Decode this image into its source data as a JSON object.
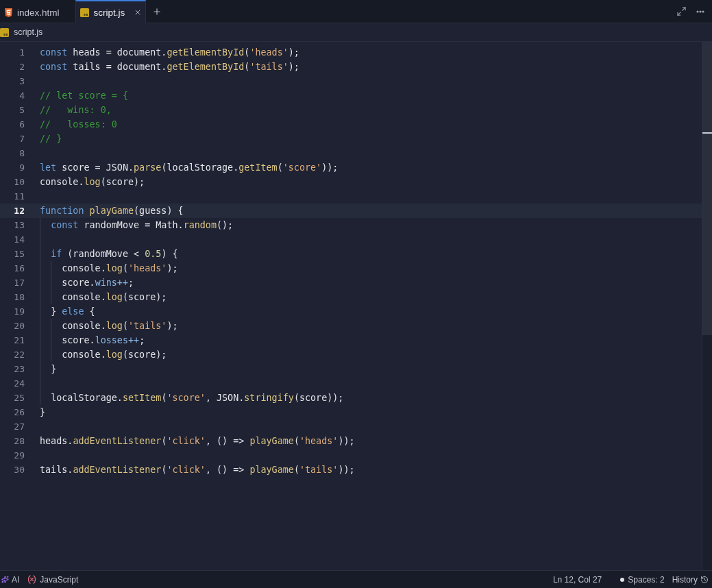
{
  "tabs": [
    {
      "label": "index.html",
      "kind": "html",
      "selected": false
    },
    {
      "label": "script.js",
      "kind": "js",
      "selected": true
    }
  ],
  "breadcrumb": {
    "label": "script.js",
    "kind": "js"
  },
  "editor": {
    "lines": [
      {
        "number": "1",
        "current": false,
        "tokens": [
          {
            "kind": "keyword",
            "text": "const"
          },
          {
            "kind": "plain",
            "text": " heads = document."
          },
          {
            "kind": "function",
            "text": "getElementById"
          },
          {
            "kind": "plain",
            "text": "("
          },
          {
            "kind": "string",
            "text": "'heads'"
          },
          {
            "kind": "plain",
            "text": ");"
          }
        ]
      },
      {
        "number": "2",
        "current": false,
        "tokens": [
          {
            "kind": "keyword",
            "text": "const"
          },
          {
            "kind": "plain",
            "text": " tails = document."
          },
          {
            "kind": "function",
            "text": "getElementById"
          },
          {
            "kind": "plain",
            "text": "("
          },
          {
            "kind": "string",
            "text": "'tails'"
          },
          {
            "kind": "plain",
            "text": ");"
          }
        ]
      },
      {
        "number": "3",
        "current": false
      },
      {
        "number": "4",
        "current": false,
        "tokens": [
          {
            "kind": "comment",
            "text": "// let score = {"
          }
        ]
      },
      {
        "number": "5",
        "current": false,
        "tokens": [
          {
            "kind": "comment",
            "text": "//   wins: 0,"
          }
        ]
      },
      {
        "number": "6",
        "current": false,
        "tokens": [
          {
            "kind": "comment",
            "text": "//   losses: 0"
          }
        ]
      },
      {
        "number": "7",
        "current": false,
        "tokens": [
          {
            "kind": "comment",
            "text": "// }"
          }
        ]
      },
      {
        "number": "8",
        "current": false
      },
      {
        "number": "9",
        "current": false,
        "tokens": [
          {
            "kind": "keyword",
            "text": "let"
          },
          {
            "kind": "plain",
            "text": " score = JSON."
          },
          {
            "kind": "function",
            "text": "parse"
          },
          {
            "kind": "plain",
            "text": "(localStorage."
          },
          {
            "kind": "function",
            "text": "getItem"
          },
          {
            "kind": "plain",
            "text": "("
          },
          {
            "kind": "string",
            "text": "'score'"
          },
          {
            "kind": "plain",
            "text": "));"
          }
        ]
      },
      {
        "number": "10",
        "current": false,
        "tokens": [
          {
            "kind": "plain",
            "text": "console."
          },
          {
            "kind": "function",
            "text": "log"
          },
          {
            "kind": "plain",
            "text": "(score);"
          }
        ]
      },
      {
        "number": "11",
        "current": false
      },
      {
        "number": "12",
        "current": true,
        "tokens": [
          {
            "kind": "keyword",
            "text": "function "
          },
          {
            "kind": "function",
            "text": "playGame"
          },
          {
            "kind": "plain",
            "text": "(guess) {"
          }
        ]
      },
      {
        "number": "13",
        "current": false,
        "tokens": [
          {
            "kind": "keyword",
            "text": "  const"
          },
          {
            "kind": "plain",
            "text": " randomMove = Math."
          },
          {
            "kind": "function",
            "text": "random"
          },
          {
            "kind": "plain",
            "text": "();"
          }
        ]
      },
      {
        "number": "14",
        "current": false
      },
      {
        "number": "15",
        "current": false,
        "tokens": [
          {
            "kind": "keyword",
            "text": "  if"
          },
          {
            "kind": "plain",
            "text": " (randomMove < "
          },
          {
            "kind": "number",
            "text": "0.5"
          },
          {
            "kind": "plain",
            "text": ") {"
          }
        ]
      },
      {
        "number": "16",
        "current": false,
        "tokens": [
          {
            "kind": "plain",
            "text": "    console."
          },
          {
            "kind": "function",
            "text": "log"
          },
          {
            "kind": "plain",
            "text": "("
          },
          {
            "kind": "string",
            "text": "'heads'"
          },
          {
            "kind": "plain",
            "text": ");"
          }
        ]
      },
      {
        "number": "17",
        "current": false,
        "tokens": [
          {
            "kind": "plain",
            "text": "    score."
          },
          {
            "kind": "property",
            "text": "wins++"
          },
          {
            "kind": "plain",
            "text": ";"
          }
        ]
      },
      {
        "number": "18",
        "current": false,
        "tokens": [
          {
            "kind": "plain",
            "text": "    console."
          },
          {
            "kind": "function",
            "text": "log"
          },
          {
            "kind": "plain",
            "text": "(score);"
          }
        ]
      },
      {
        "number": "19",
        "current": false,
        "tokens": [
          {
            "kind": "plain",
            "text": "  } "
          },
          {
            "kind": "keyword",
            "text": "else"
          },
          {
            "kind": "plain",
            "text": " {"
          }
        ]
      },
      {
        "number": "20",
        "current": false,
        "tokens": [
          {
            "kind": "plain",
            "text": "    console."
          },
          {
            "kind": "function",
            "text": "log"
          },
          {
            "kind": "plain",
            "text": "("
          },
          {
            "kind": "string",
            "text": "'tails'"
          },
          {
            "kind": "plain",
            "text": ");"
          }
        ]
      },
      {
        "number": "21",
        "current": false,
        "tokens": [
          {
            "kind": "plain",
            "text": "    score."
          },
          {
            "kind": "property",
            "text": "losses++"
          },
          {
            "kind": "plain",
            "text": ";"
          }
        ]
      },
      {
        "number": "22",
        "current": false,
        "tokens": [
          {
            "kind": "plain",
            "text": "    console."
          },
          {
            "kind": "function",
            "text": "log"
          },
          {
            "kind": "plain",
            "text": "(score);"
          }
        ]
      },
      {
        "number": "23",
        "current": false,
        "tokens": [
          {
            "kind": "plain",
            "text": "  }"
          }
        ]
      },
      {
        "number": "24",
        "current": false
      },
      {
        "number": "25",
        "current": false,
        "tokens": [
          {
            "kind": "plain",
            "text": "  localStorage."
          },
          {
            "kind": "function",
            "text": "setItem"
          },
          {
            "kind": "plain",
            "text": "("
          },
          {
            "kind": "string",
            "text": "'score'"
          },
          {
            "kind": "plain",
            "text": ", JSON."
          },
          {
            "kind": "function",
            "text": "stringify"
          },
          {
            "kind": "plain",
            "text": "(score));"
          }
        ]
      },
      {
        "number": "26",
        "current": false,
        "tokens": [
          {
            "kind": "plain",
            "text": "}"
          }
        ]
      },
      {
        "number": "27",
        "current": false
      },
      {
        "number": "28",
        "current": false,
        "tokens": [
          {
            "kind": "plain",
            "text": "heads."
          },
          {
            "kind": "function",
            "text": "addEventListener"
          },
          {
            "kind": "plain",
            "text": "("
          },
          {
            "kind": "string",
            "text": "'click'"
          },
          {
            "kind": "plain",
            "text": ", () => "
          },
          {
            "kind": "function",
            "text": "playGame"
          },
          {
            "kind": "plain",
            "text": "("
          },
          {
            "kind": "string",
            "text": "'heads'"
          },
          {
            "kind": "plain",
            "text": "));"
          }
        ]
      },
      {
        "number": "29",
        "current": false
      },
      {
        "number": "30",
        "current": false,
        "tokens": [
          {
            "kind": "plain",
            "text": "tails."
          },
          {
            "kind": "function",
            "text": "addEventListener"
          },
          {
            "kind": "plain",
            "text": "("
          },
          {
            "kind": "string",
            "text": "'click'"
          },
          {
            "kind": "plain",
            "text": ", () => "
          },
          {
            "kind": "function",
            "text": "playGame"
          },
          {
            "kind": "plain",
            "text": "("
          },
          {
            "kind": "string",
            "text": "'tails'"
          },
          {
            "kind": "plain",
            "text": "));"
          }
        ]
      }
    ]
  },
  "status_bar": {
    "left": [
      {
        "label": "AI",
        "kind": "ai"
      },
      {
        "label": "JavaScript",
        "kind": "language"
      }
    ],
    "right": [
      {
        "label": "Ln 12, Col 27",
        "kind": "position"
      },
      {
        "label": "Spaces: 2",
        "kind": "indent"
      },
      {
        "label": "History",
        "kind": "history"
      }
    ]
  }
}
